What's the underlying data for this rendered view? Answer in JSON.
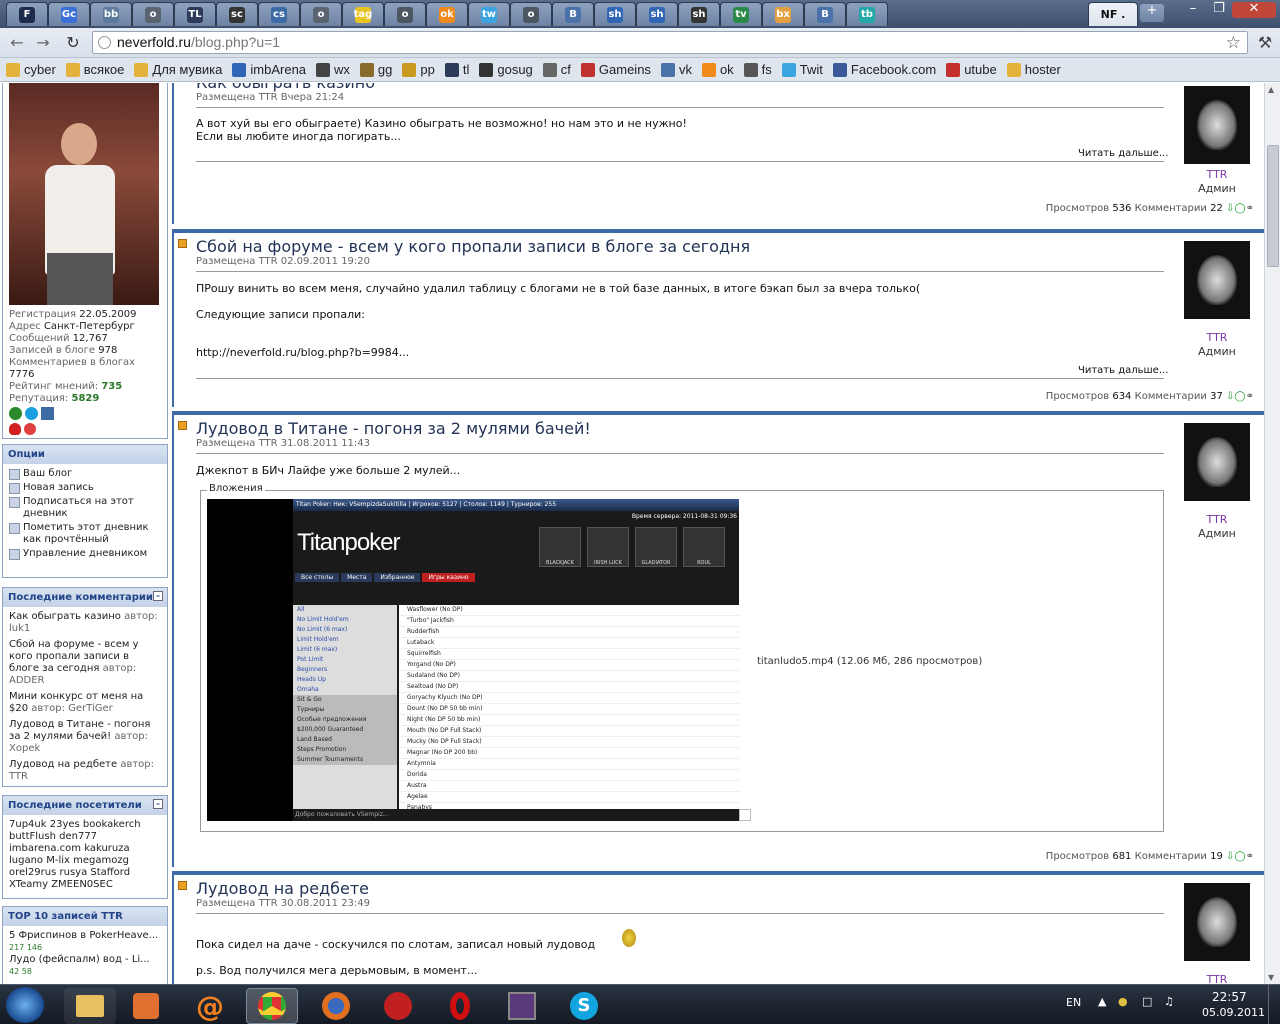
{
  "browser": {
    "tabs": [
      {
        "icon": "F",
        "color": "#1c2b4c"
      },
      {
        "icon": "Gc",
        "color": "#3a6fd8"
      },
      {
        "icon": "bb",
        "color": "#5d7a9c"
      },
      {
        "icon": "o",
        "color": "#5a6370"
      },
      {
        "icon": "TL",
        "color": "#2d3a5a"
      },
      {
        "icon": "sc",
        "color": "#333"
      },
      {
        "icon": "cs",
        "color": "#3d6aa5"
      },
      {
        "icon": "o",
        "color": "#5a6370"
      },
      {
        "icon": "tag",
        "color": "#e8c420"
      },
      {
        "icon": "o",
        "color": "#4c5560"
      },
      {
        "icon": "ok",
        "color": "#f08a1a"
      },
      {
        "icon": "tw",
        "color": "#3aa5e0"
      },
      {
        "icon": "o",
        "color": "#4c5560"
      },
      {
        "icon": "B",
        "color": "#4a72a8"
      },
      {
        "icon": "sh",
        "color": "#3066b5"
      },
      {
        "icon": "sh",
        "color": "#3066b5"
      },
      {
        "icon": "sh",
        "color": "#333"
      },
      {
        "icon": "tv",
        "color": "#2a8a4a"
      },
      {
        "icon": "bx",
        "color": "#e3a040"
      },
      {
        "icon": "B",
        "color": "#4a72a8"
      },
      {
        "icon": "tb",
        "color": "#22a8a8"
      }
    ],
    "active_tab_label": "NF .",
    "new_tab_label": "+",
    "window_controls": [
      "–",
      "❐",
      "✕"
    ],
    "url_host": "neverfold.ru",
    "url_path": "/blog.php?u=1"
  },
  "bookmarks": [
    {
      "label": "cyber",
      "color": "#e3b23c"
    },
    {
      "label": "всякое",
      "color": "#e3b23c"
    },
    {
      "label": "Для мувика",
      "color": "#e3b23c"
    },
    {
      "label": "imbArena",
      "color": "#3066b5"
    },
    {
      "label": "wx",
      "color": "#444"
    },
    {
      "label": "gg",
      "color": "#8a6a2a"
    },
    {
      "label": "pp",
      "color": "#c89a20"
    },
    {
      "label": "tl",
      "color": "#2d3a5a"
    },
    {
      "label": "gosug",
      "color": "#333"
    },
    {
      "label": "cf",
      "color": "#666"
    },
    {
      "label": "Gameins",
      "color": "#c03030"
    },
    {
      "label": "vk",
      "color": "#4a72a8"
    },
    {
      "label": "ok",
      "color": "#f08a1a"
    },
    {
      "label": "fs",
      "color": "#555"
    },
    {
      "label": "Twit",
      "color": "#3aa5e0"
    },
    {
      "label": "Facebook.com",
      "color": "#3b5998"
    },
    {
      "label": "utube",
      "color": "#c4302b"
    },
    {
      "label": "hoster",
      "color": "#e3b23c"
    }
  ],
  "profile": {
    "reg_label": "Регистрация",
    "reg_value": "22.05.2009",
    "addr_label": "Адрес",
    "addr_value": "Санкт-Петербург",
    "msgs_label": "Сообщений",
    "msgs_value": "12,767",
    "blog_label": "Записей в блоге",
    "blog_value": "978",
    "comments_label": "Комментариев в блогах",
    "comments_value": "7776",
    "rating_label": "Рейтинг мнений:",
    "rating_value": "735",
    "rep_label": "Репутация:",
    "rep_value": "5829"
  },
  "options": {
    "title": "Опции",
    "items": [
      "Ваш блог",
      "Новая запись",
      "Подписаться на этот дневник",
      "Пометить этот дневник как прочтённый",
      "Управление дневником"
    ]
  },
  "recent_comments": {
    "title": "Последние комментарии",
    "items": [
      {
        "text": "Как обыграть казино",
        "author_label": "автор:",
        "author": "luk1"
      },
      {
        "text": "Сбой на форуме - всем у кого пропали записи в блоге за сегодня",
        "author_label": "автор:",
        "author": "ADDER"
      },
      {
        "text": "Мини конкурс от меня на $20",
        "author_label": "автор:",
        "author": "GerTiGer"
      },
      {
        "text": "Лудовод в Титане - погоня за 2 мулями бачей!",
        "author_label": "автор:",
        "author": "Xopek"
      },
      {
        "text": "Лудовод на редбете",
        "author_label": "автор:",
        "author": "TTR"
      }
    ]
  },
  "recent_visitors": {
    "title": "Последние посетители",
    "lines": [
      "7up4uk 23yes bookakerch",
      "buttFlush den777",
      "imbarena.com kakuruza",
      "lugano M-lix megamozg",
      "orel29rus rusya Stafford",
      "XTeamy ZMEEN0SEC"
    ]
  },
  "top10": {
    "title": "TOP 10 записей TTR",
    "items": [
      {
        "text": "5 Фриспинов в PokerHeave...",
        "stats": "217 146"
      },
      {
        "text": "Лудо (фейспалм) вод - Li...",
        "stats": "42 58"
      }
    ]
  },
  "posts": [
    {
      "title": "Как обыграть казино",
      "meta": "Размещена TTR Вчера 21:24",
      "text1": "А вот хуй вы его обыграете) Казино обыграть не возможно! но нам это и не нужно!",
      "text2": "Если вы любите иногда погирать...",
      "more": "Читать дальше...",
      "views_label": "Просмотров",
      "views": "536",
      "comments_label": "Комментарии",
      "comments": "22",
      "author": "TTR",
      "role": "Админ"
    },
    {
      "title": "Сбой на форуме - всем у кого пропали записи в блоге за сегодня",
      "meta": "Размещена TTR 02.09.2011 19:20",
      "text1": "ПРошу винить во всем меня, случайно удалил таблицу с блогами не в той базе данных, в итоге бэкап был за вчера только(",
      "text2": "Следующие записи пропали:",
      "text3": "http://neverfold.ru/blog.php?b=9984...",
      "more": "Читать дальше...",
      "views_label": "Просмотров",
      "views": "634",
      "comments_label": "Комментарии",
      "comments": "37",
      "author": "TTR",
      "role": "Админ"
    },
    {
      "title": "Лудовод в Титане - погоня за 2 мулями бачей!",
      "meta": "Размещена TTR 31.08.2011 11:43",
      "text1": "Джекпот в БИч Лайфе уже больше 2 мулей...",
      "attach_legend": "Вложения",
      "attach_file": "titanludo5.mp4 (12.06 Мб, 286 просмотров)",
      "views_label": "Просмотров",
      "views": "681",
      "comments_label": "Комментарии",
      "comments": "19",
      "author": "TTR",
      "role": "Админ"
    },
    {
      "title": "Лудовод на редбете",
      "meta": "Размещена TTR 30.08.2011 23:49",
      "text1": "Пока сидел на даче - соскучился по слотам, записал новый лудовод",
      "text2": "p.s. Вод получился мега дерьмовым, в момент...",
      "author": "TTR"
    }
  ],
  "titan": {
    "header": "Titan Poker: Ник: VSempizdaSukitilla | Игроков: 5127 | Столов: 1149 | Турниров: 255",
    "server_time": "Время сервера: 2011-08-31 09:36",
    "logo": "Titanpoker",
    "games": [
      "BLACKJACK",
      "IRISH LUCK",
      "GLADIATOR",
      "ROUL"
    ],
    "tabs": [
      "Все столы",
      "Места",
      "Избранное",
      "Игры казино"
    ],
    "menu": [
      "All",
      "No Limit Hold'em",
      "No Limit (6 max)",
      "Limit Hold'em",
      "Limit (6 max)",
      "Pot Limit",
      "Beginners",
      "Heads Up",
      "Omaha",
      "Sit & Go",
      "Турниры",
      "Особые предложения",
      "$200,000 Guaranteed",
      "Land Based",
      "Steps Promotion",
      "Summer Tournaments"
    ],
    "rooms": [
      "Wasflower (No DP)",
      "\"Turbo\" Jackfish",
      "Rudderfish",
      "Lutaback",
      "Squirrelfish",
      "Yorgand (No DP)",
      "Sudaland (No DP)",
      "Sealtoad (No DP)",
      "Goryachy Klyuch (No DP)",
      "Dount (No DP 50 bb min)",
      "Night (No DP 50 bb min)",
      "Mouth (No DP Full Stack)",
      "Mucky (No DP Full Stack)",
      "Magnar (No DP 200 bb)",
      "Antymnia",
      "Dorida",
      "Austra",
      "Agelae",
      "Panabys"
    ],
    "bottom": "Добро пожаловать VSempiz..."
  },
  "taskbar": {
    "lang": "EN",
    "time": "22:57",
    "date": "05.09.2011"
  }
}
